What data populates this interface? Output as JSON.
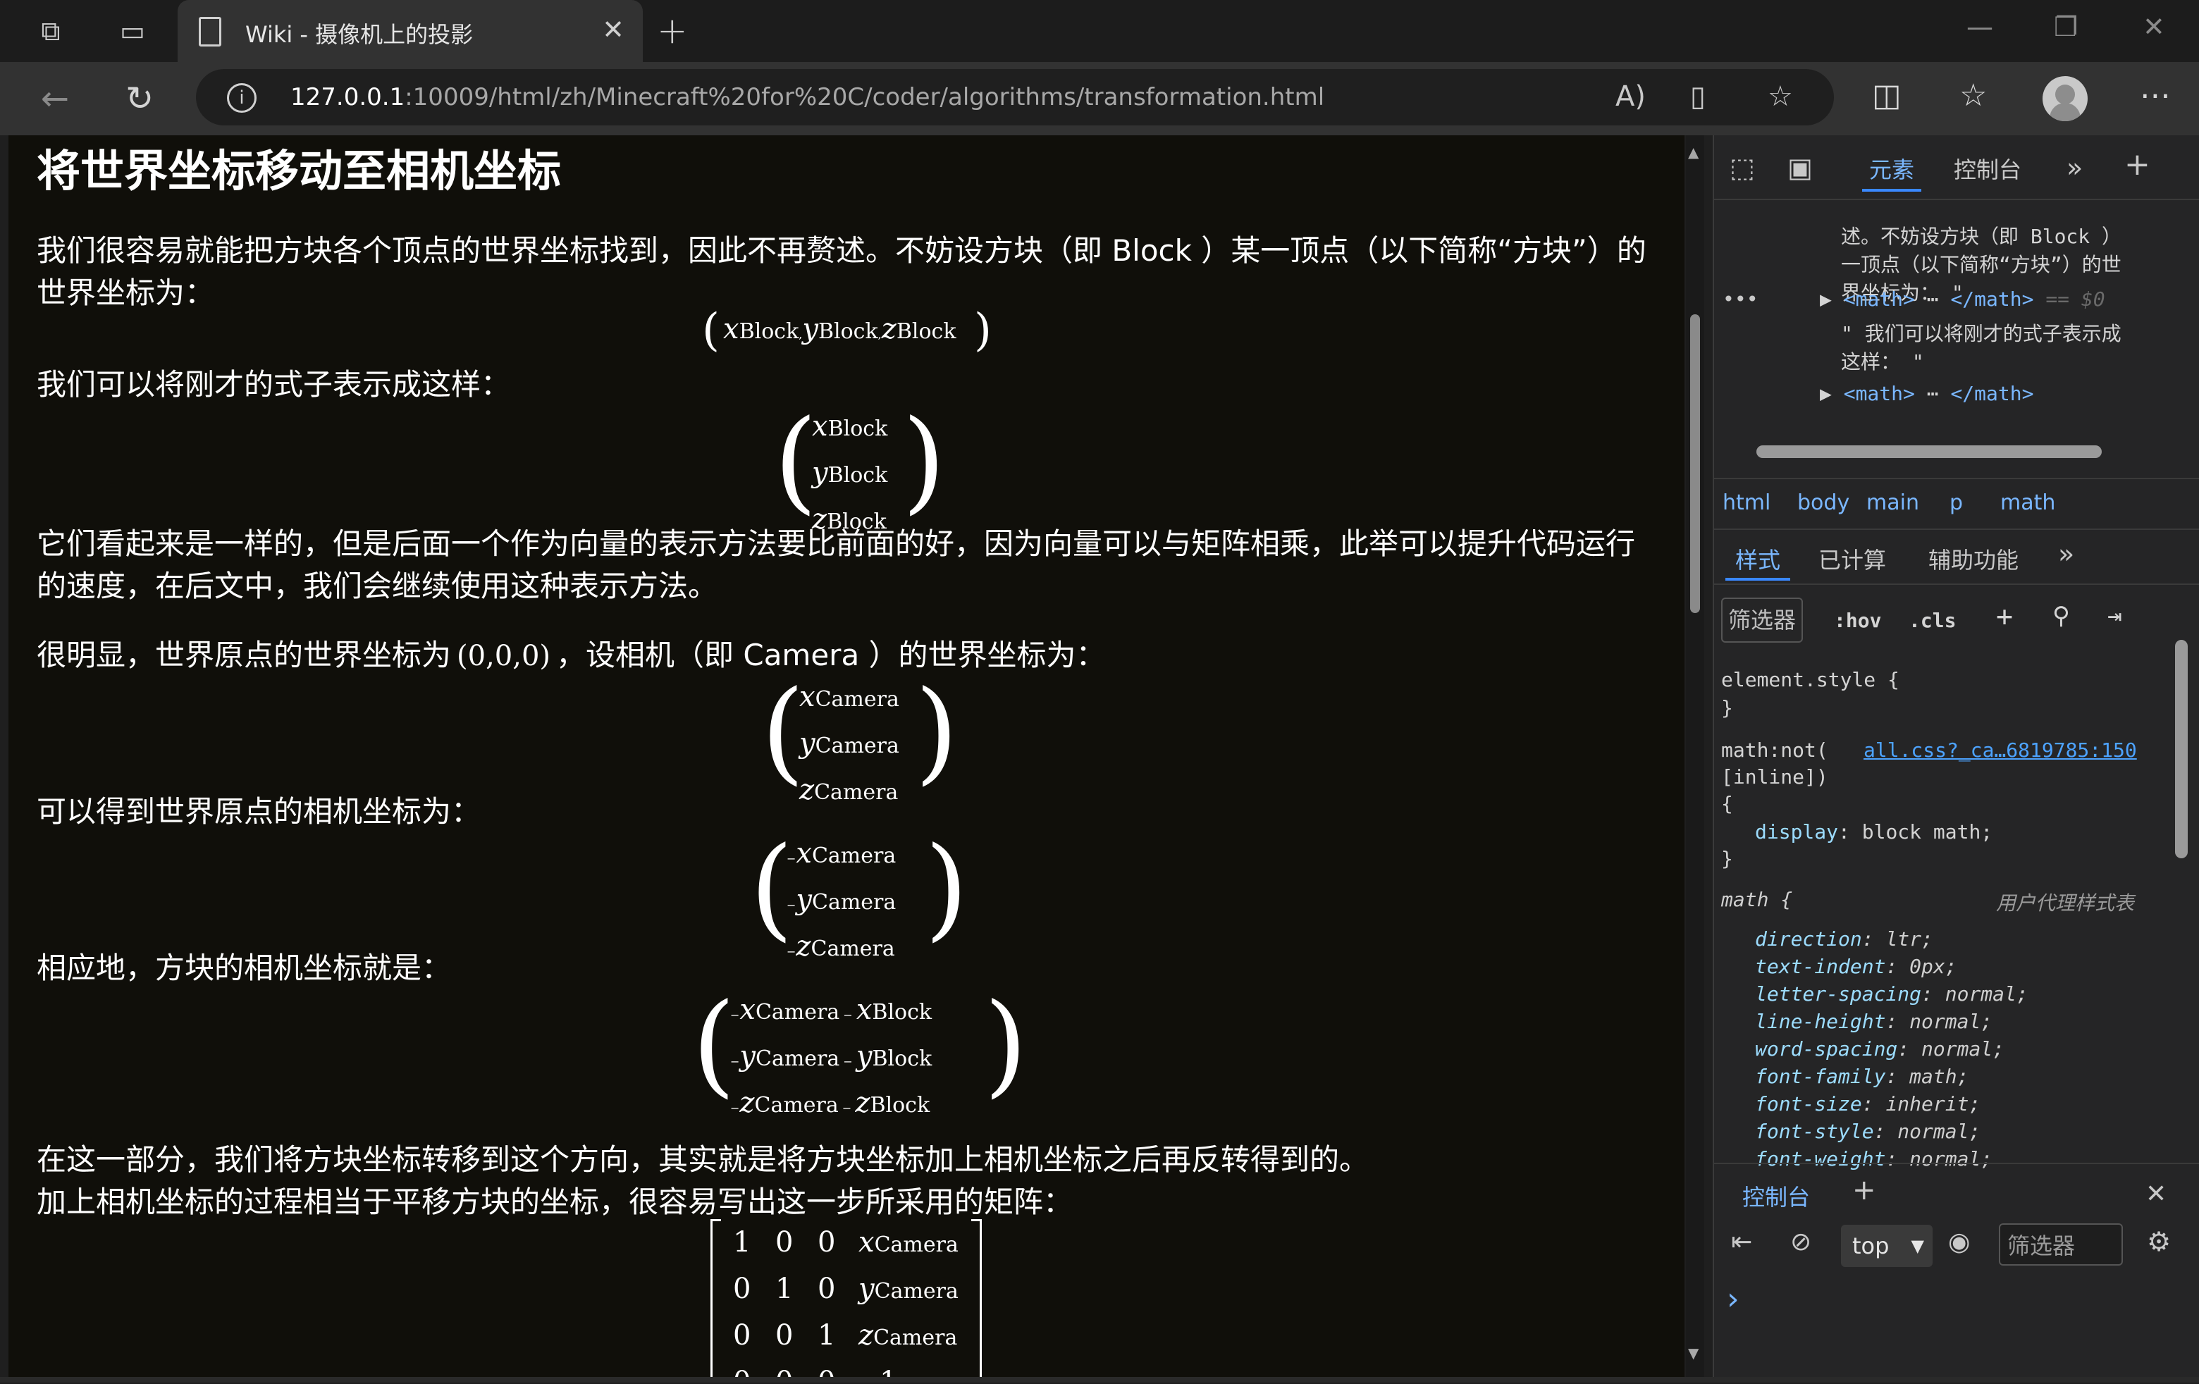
{
  "browser": {
    "tab_title": "Wiki - 摄像机上的投影",
    "url_host": "127.0.0.1",
    "url_path": ":10009/html/zh/Minecraft%20for%20C/coder/algorithms/transformation.html",
    "icons": [
      "workspaces-icon",
      "tab-actions-icon",
      "back-icon",
      "refresh-icon",
      "info-icon",
      "read-aloud-icon",
      "immersive-reader-icon",
      "favorite-star-icon",
      "split-screen-icon",
      "favorites-icon",
      "profile-avatar",
      "more-icon"
    ]
  },
  "page": {
    "heading": "将世界坐标移动至相机坐标",
    "p1": "我们很容易就能把方块各个顶点的世界坐标找到，因此不再赘述。不妨设方块（即 Block ）某一顶点（以下简称“方块”）的世界坐标为：",
    "p2": "我们可以将刚才的式子表示成这样：",
    "p3": "它们看起来是一样的，但是后面一个作为向量的表示方法要比前面的好，因为向量可以与矩阵相乘，此举可以提升代码运行的速度，在后文中，我们会继续使用这种表示方法。",
    "p4a": "很明显，世界原点的世界坐标为",
    "p4origin": "(0,0,0)",
    "p4b": "，设相机（即 Camera ）的世界坐标为：",
    "p5": "可以得到世界原点的相机坐标为：",
    "p6": "相应地，方块的相机坐标就是：",
    "p7": "在这一部分，我们将方块坐标转移到这个方向，其实就是将方块坐标加上相机坐标之后再反转得到的。",
    "p8": "加上相机坐标的过程相当于平移方块的坐标，很容易写出这一步所采用的矩阵：",
    "math": {
      "x": "x",
      "y": "y",
      "z": "z",
      "block": "Block",
      "camera": "Camera",
      "neg": "−",
      "minus": "−",
      "comma": ",",
      "zero": "0",
      "one": "1"
    }
  },
  "devtools": {
    "tabs": [
      "元素",
      "控制台"
    ],
    "dom_lines": [
      "述。不妨设方块（即 Block ）",
      "一顶点（以下简称“方块”）的世",
      "界坐标为：  \"",
      "<math>",
      "</math>",
      "== $0",
      "\" 我们可以将刚才的式子表示成",
      "这样： \"",
      "<math>",
      "</math>"
    ],
    "breadcrumbs": [
      "html",
      "body",
      "main",
      "p",
      "math"
    ],
    "subtabs": [
      "样式",
      "已计算",
      "辅助功能"
    ],
    "filter_label": "筛选器",
    "hov": ":hov",
    "cls": ".cls",
    "element_style": "element.style {",
    "close_brace": "}",
    "rule1_selector_a": "math:not(",
    "rule1_selector_b": "[inline])",
    "rule1_source": "all.css?_ca…6819785:150",
    "open_brace": "{",
    "rule1_prop": "display",
    "rule1_val": "block math;",
    "ua_selector": "math {",
    "ua_label": "用户代理样式表",
    "ua_props": [
      [
        "direction",
        "ltr;"
      ],
      [
        "text-indent",
        "0px;"
      ],
      [
        "letter-spacing",
        "normal;"
      ],
      [
        "line-height",
        "normal;"
      ],
      [
        "word-spacing",
        "normal;"
      ],
      [
        "font-family",
        "math;"
      ],
      [
        "font-size",
        "inherit;"
      ],
      [
        "font-style",
        "normal;"
      ],
      [
        "font-weight",
        "normal;"
      ]
    ],
    "console_tab": "控制台",
    "context": "top",
    "console_filter": "筛选器",
    "prompt": "›"
  }
}
